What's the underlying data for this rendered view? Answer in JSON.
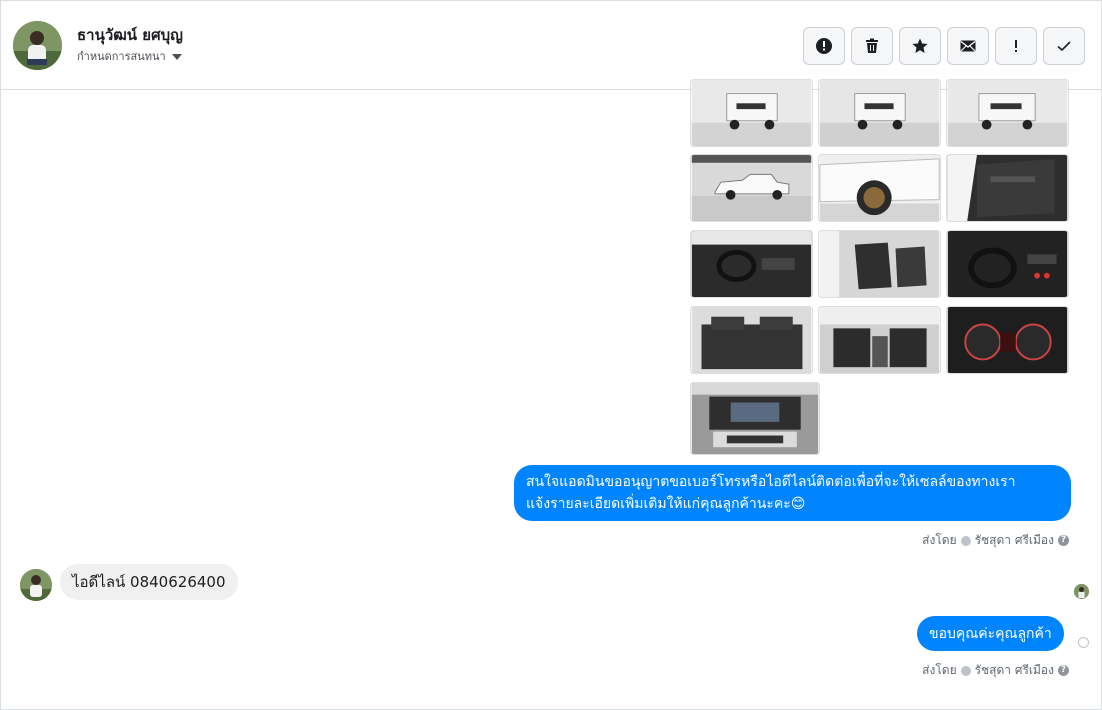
{
  "conversation": {
    "contact_name": "ธานุวัฒน์ ยศบุญ",
    "assign_label": "กำหนดการสนทนา"
  },
  "actions": [
    {
      "name": "report-spam-button",
      "icon": "alert-circle-icon"
    },
    {
      "name": "delete-button",
      "icon": "trash-icon"
    },
    {
      "name": "star-button",
      "icon": "star-icon"
    },
    {
      "name": "mark-unread-button",
      "icon": "envelope-icon"
    },
    {
      "name": "follow-up-button",
      "icon": "exclamation-icon"
    },
    {
      "name": "mark-done-button",
      "icon": "check-icon"
    }
  ],
  "photos": [
    {
      "subject": "pickup-rear"
    },
    {
      "subject": "pickup-rear"
    },
    {
      "subject": "pickup-rear-angle"
    },
    {
      "subject": "pickup-side"
    },
    {
      "subject": "wheel-closeup"
    },
    {
      "subject": "door-open"
    },
    {
      "subject": "dashboard"
    },
    {
      "subject": "front-seats"
    },
    {
      "subject": "steering-wheel"
    },
    {
      "subject": "rear-seats"
    },
    {
      "subject": "cabin-interior"
    },
    {
      "subject": "gauge-cluster"
    },
    {
      "subject": "engine-bay"
    }
  ],
  "messages": [
    {
      "direction": "outgoing",
      "line1": "สนใจแอดมินขออนุญาตขอเบอร์โทรหรือไอดีไลน์ติดต่อเพื่อที่จะให้เซลล์ของทางเรา",
      "line2": "แจ้งรายละเอียดเพิ่มเติมให้แก่คุณลูกค้านะคะ😊",
      "sent_by_prefix": "ส่งโดย",
      "sender": "รัชสุดา ศรีเมือง"
    },
    {
      "direction": "incoming",
      "text": "ไอดีไลน์ 0840626400"
    },
    {
      "direction": "outgoing",
      "text": "ขอบคุณค่ะคุณลูกค้า",
      "sent_by_prefix": "ส่งโดย",
      "sender": "รัชสุดา ศรีเมือง"
    }
  ],
  "colors": {
    "outgoing_bubble": "#0084ff",
    "incoming_bubble": "#f1f0f0"
  }
}
